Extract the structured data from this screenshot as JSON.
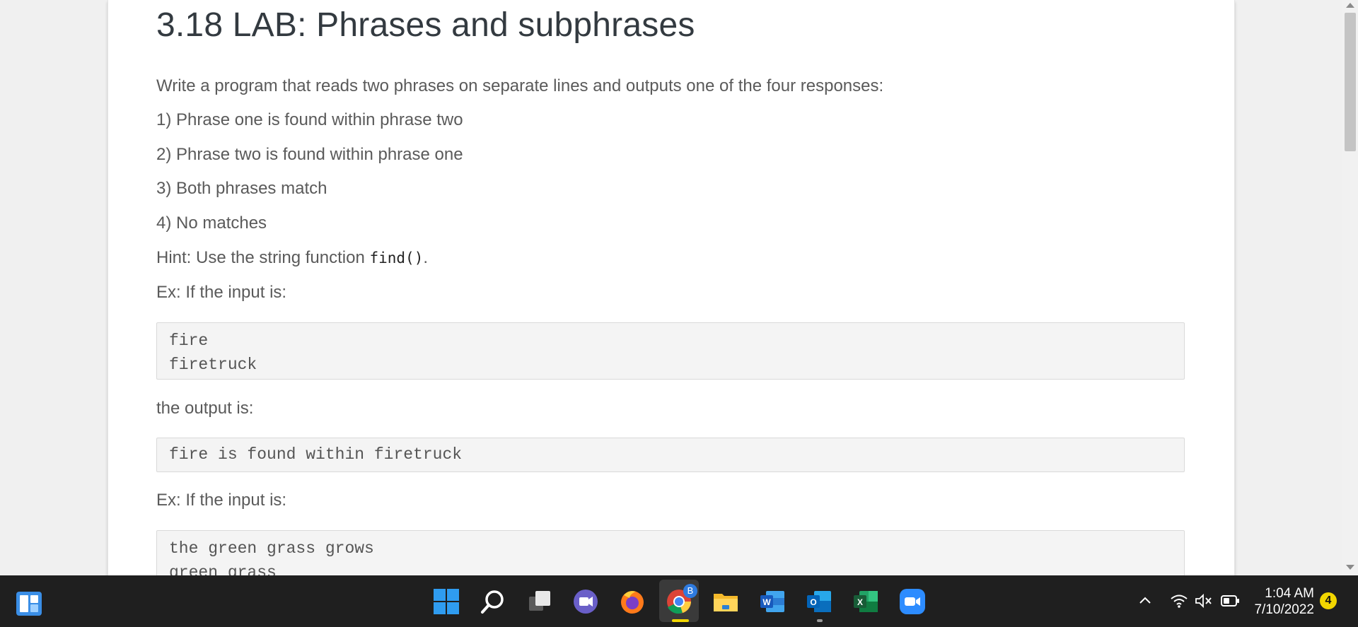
{
  "lab": {
    "title": "3.18 LAB: Phrases and subphrases",
    "intro": "Write a program that reads two phrases on separate lines and outputs one of the four responses:",
    "responses": [
      "1) Phrase one is found within phrase two",
      "2) Phrase two is found within phrase one",
      "3) Both phrases match",
      "4) No matches"
    ],
    "hint_prefix": "Hint: Use the string function ",
    "hint_code": "find()",
    "hint_suffix": ".",
    "example1_intro": "Ex: If the input is:",
    "example1_input": [
      "fire",
      "firetruck"
    ],
    "output_intro": "the output is:",
    "example1_output": [
      "fire is found within firetruck"
    ],
    "example2_intro": "Ex: If the input is:",
    "example2_input": [
      "the green grass grows",
      "green grass"
    ]
  },
  "taskbar": {
    "apps": [
      "start-icon",
      "search-icon",
      "task-view-icon",
      "chat-icon",
      "firefox-icon",
      "chrome-icon",
      "file-explorer-icon",
      "word-icon",
      "outlook-icon",
      "excel-icon",
      "zoom-icon"
    ],
    "chrome_badge": "B",
    "clock_time": "1:04 AM",
    "clock_date": "7/10/2022",
    "notification_count": "4"
  },
  "colors": {
    "taskbar_bg": "#1f1f1f",
    "windows_blue": "#3aa0f3",
    "notification_yellow": "#f2d600"
  }
}
